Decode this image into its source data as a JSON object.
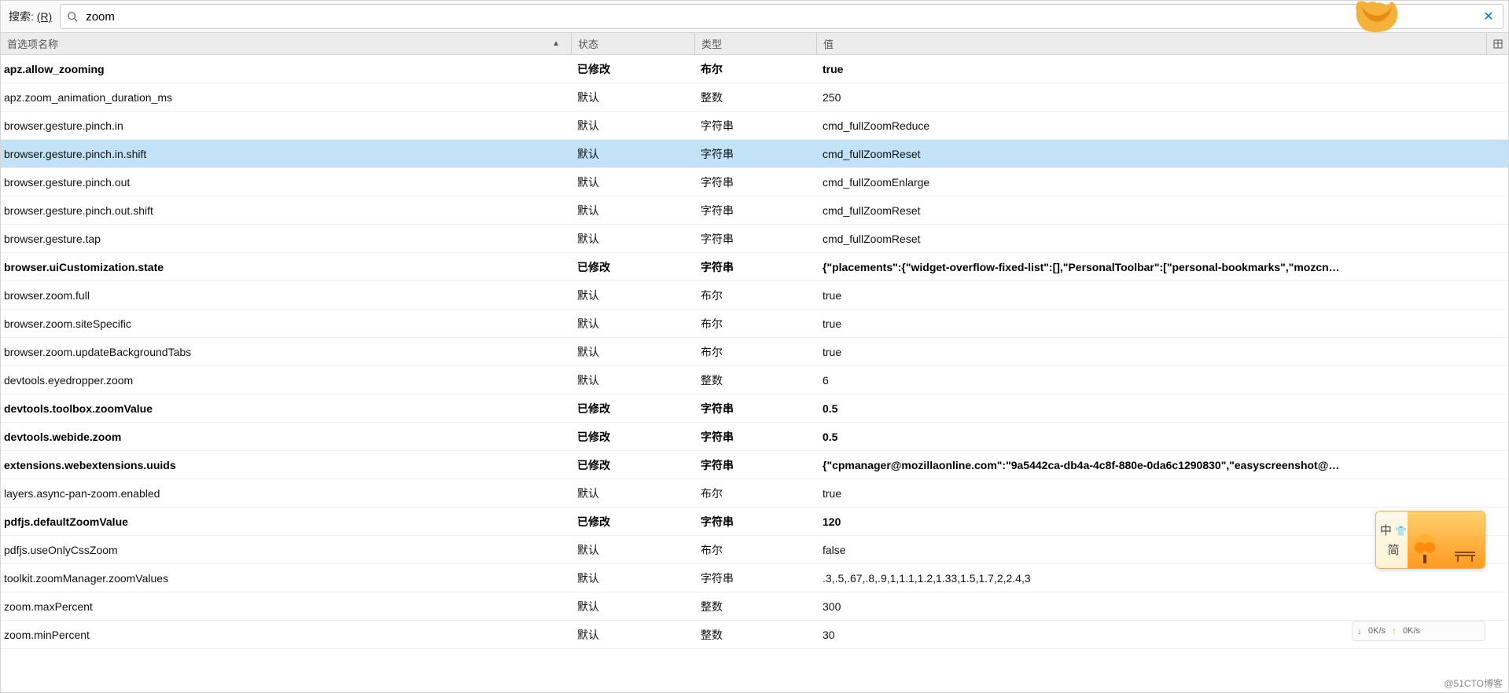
{
  "search": {
    "label_prefix": "搜索:",
    "label_accel": "(R)",
    "value": "zoom"
  },
  "headers": {
    "name": "首选项名称",
    "status": "状态",
    "type": "类型",
    "value": "值"
  },
  "rows": [
    {
      "name": "apz.allow_zooming",
      "status": "已修改",
      "type": "布尔",
      "value": "true",
      "bold": true
    },
    {
      "name": "apz.zoom_animation_duration_ms",
      "status": "默认",
      "type": "整数",
      "value": "250"
    },
    {
      "name": "browser.gesture.pinch.in",
      "status": "默认",
      "type": "字符串",
      "value": "cmd_fullZoomReduce"
    },
    {
      "name": "browser.gesture.pinch.in.shift",
      "status": "默认",
      "type": "字符串",
      "value": "cmd_fullZoomReset",
      "selected": true
    },
    {
      "name": "browser.gesture.pinch.out",
      "status": "默认",
      "type": "字符串",
      "value": "cmd_fullZoomEnlarge"
    },
    {
      "name": "browser.gesture.pinch.out.shift",
      "status": "默认",
      "type": "字符串",
      "value": "cmd_fullZoomReset"
    },
    {
      "name": "browser.gesture.tap",
      "status": "默认",
      "type": "字符串",
      "value": "cmd_fullZoomReset"
    },
    {
      "name": "browser.uiCustomization.state",
      "status": "已修改",
      "type": "字符串",
      "value": "{\"placements\":{\"widget-overflow-fixed-list\":[],\"PersonalToolbar\":[\"personal-bookmarks\",\"mozcn…",
      "bold": true
    },
    {
      "name": "browser.zoom.full",
      "status": "默认",
      "type": "布尔",
      "value": "true"
    },
    {
      "name": "browser.zoom.siteSpecific",
      "status": "默认",
      "type": "布尔",
      "value": "true"
    },
    {
      "name": "browser.zoom.updateBackgroundTabs",
      "status": "默认",
      "type": "布尔",
      "value": "true"
    },
    {
      "name": "devtools.eyedropper.zoom",
      "status": "默认",
      "type": "整数",
      "value": "6"
    },
    {
      "name": "devtools.toolbox.zoomValue",
      "status": "已修改",
      "type": "字符串",
      "value": "0.5",
      "bold": true
    },
    {
      "name": "devtools.webide.zoom",
      "status": "已修改",
      "type": "字符串",
      "value": "0.5",
      "bold": true
    },
    {
      "name": "extensions.webextensions.uuids",
      "status": "已修改",
      "type": "字符串",
      "value": "{\"cpmanager@mozillaonline.com\":\"9a5442ca-db4a-4c8f-880e-0da6c1290830\",\"easyscreenshot@…",
      "bold": true
    },
    {
      "name": "layers.async-pan-zoom.enabled",
      "status": "默认",
      "type": "布尔",
      "value": "true"
    },
    {
      "name": "pdfjs.defaultZoomValue",
      "status": "已修改",
      "type": "字符串",
      "value": "120",
      "bold": true
    },
    {
      "name": "pdfjs.useOnlyCssZoom",
      "status": "默认",
      "type": "布尔",
      "value": "false"
    },
    {
      "name": "toolkit.zoomManager.zoomValues",
      "status": "默认",
      "type": "字符串",
      "value": ".3,.5,.67,.8,.9,1,1.1,1.2,1.33,1.5,1.7,2,2.4,3"
    },
    {
      "name": "zoom.maxPercent",
      "status": "默认",
      "type": "整数",
      "value": "300"
    },
    {
      "name": "zoom.minPercent",
      "status": "默认",
      "type": "整数",
      "value": "30"
    }
  ],
  "ime": {
    "line1": "中",
    "line2": "简"
  },
  "net": {
    "down": "0K/s",
    "up": "0K/s"
  },
  "watermark": "@51CTO博客"
}
